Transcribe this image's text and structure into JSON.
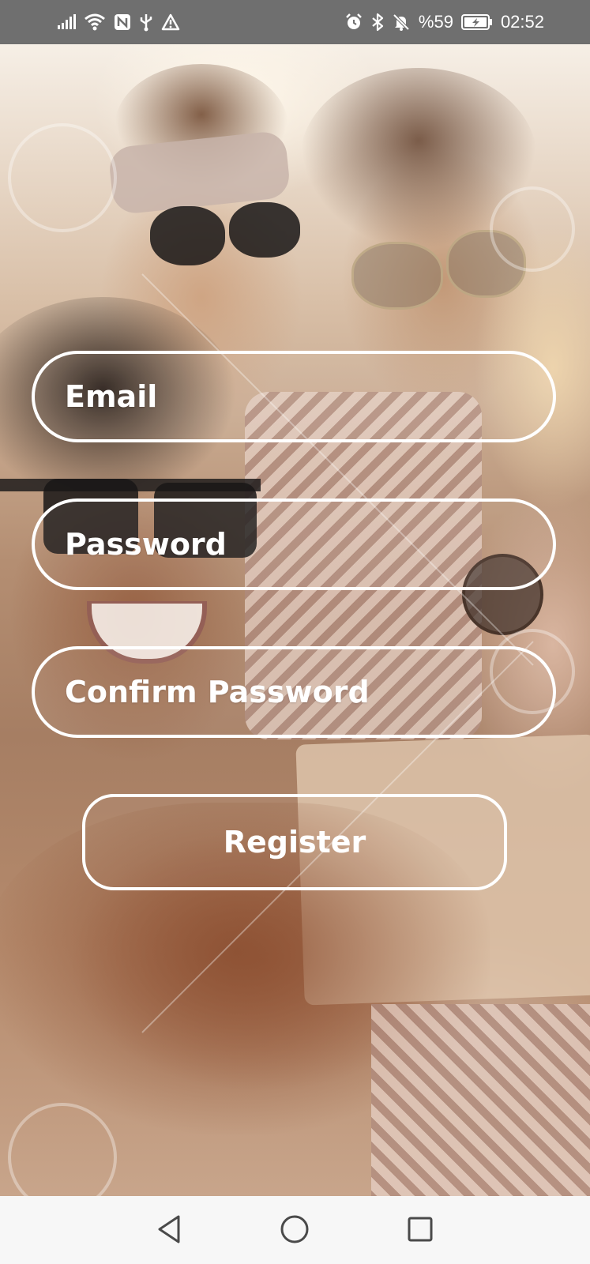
{
  "status_bar": {
    "battery_text": "%59",
    "time": "02:52",
    "icons": [
      "signal-icon",
      "wifi-icon",
      "nfc-icon",
      "usb-icon",
      "warning-icon",
      "alarm-icon",
      "bluetooth-icon",
      "bell-off-icon",
      "battery-charging-icon"
    ]
  },
  "form": {
    "email_placeholder": "Email",
    "password_placeholder": "Password",
    "confirm_password_placeholder": "Confirm Password",
    "register_label": "Register"
  },
  "nav_bar": {
    "icons": [
      "back-icon",
      "home-icon",
      "recent-apps-icon"
    ]
  },
  "colors": {
    "status_bar_bg": "#6f6f6f",
    "field_border": "#ffffff",
    "field_text": "#ffffff",
    "nav_bar_bg": "#f7f7f7",
    "nav_icon": "#4a4a4a"
  }
}
